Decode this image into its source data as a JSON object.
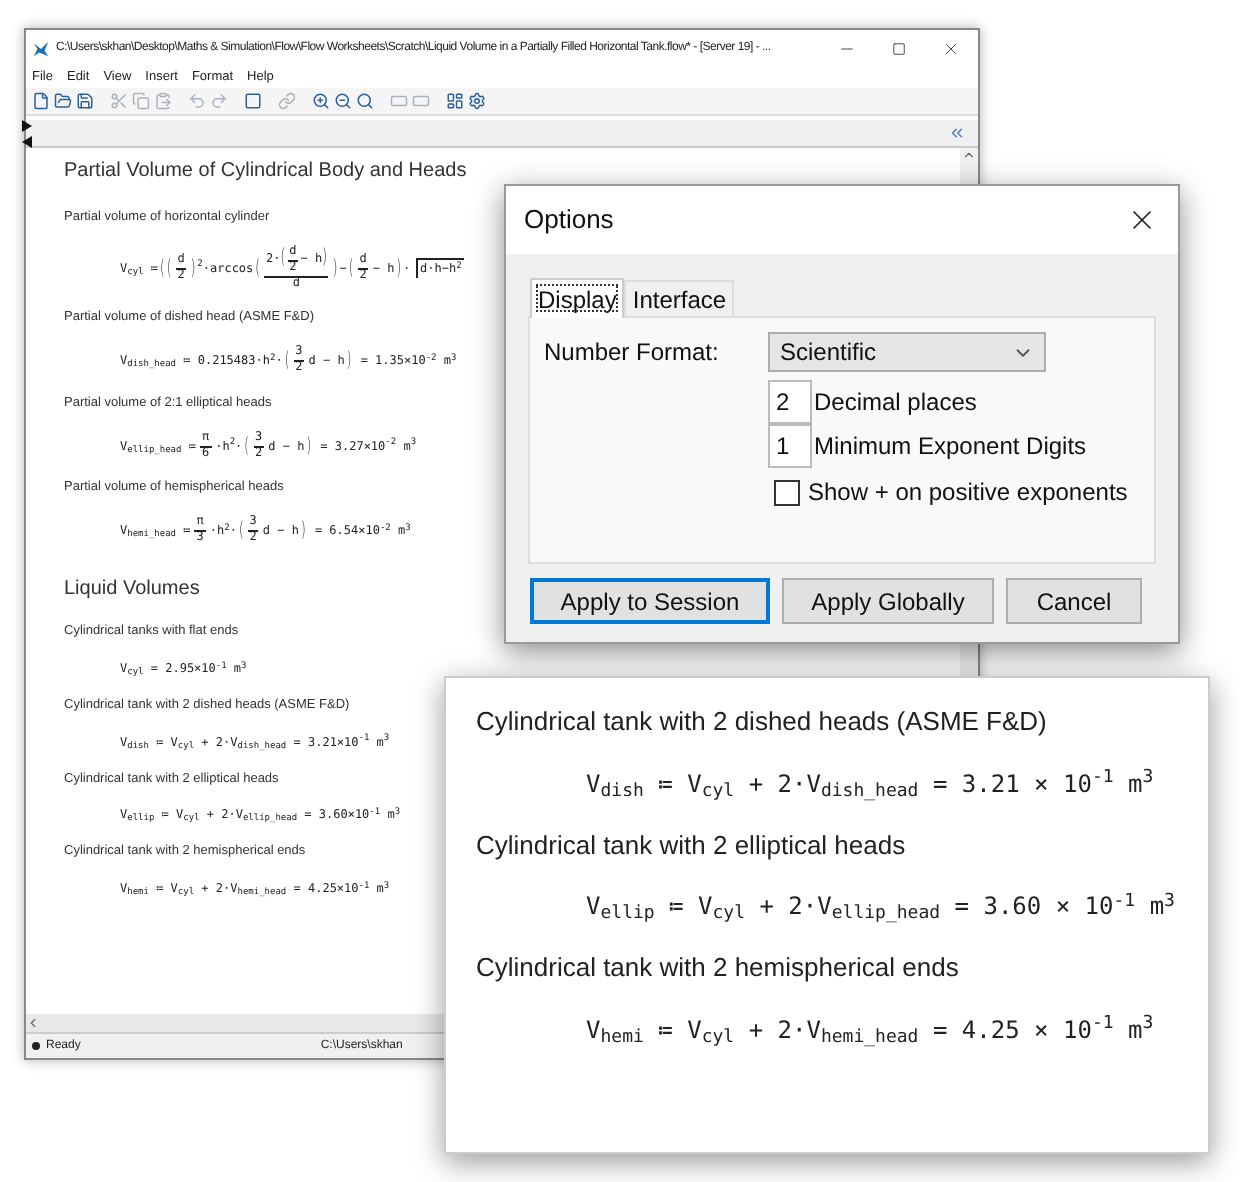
{
  "main_window": {
    "title": "C:\\Users\\skhan\\Desktop\\Maths & Simulation\\Flow\\Flow Worksheets\\Scratch\\Liquid Volume in a Partially Filled Horizontal Tank.flow* - [Server 19] - ...",
    "menu": [
      "File",
      "Edit",
      "View",
      "Insert",
      "Format",
      "Help"
    ],
    "toolbar": [
      {
        "kind": "new",
        "disabled": false
      },
      {
        "kind": "open",
        "disabled": false
      },
      {
        "kind": "save",
        "disabled": false
      },
      {
        "kind": "separator"
      },
      {
        "kind": "cut",
        "disabled": true
      },
      {
        "kind": "copy",
        "disabled": true
      },
      {
        "kind": "paste",
        "disabled": true
      },
      {
        "kind": "separator"
      },
      {
        "kind": "undo",
        "disabled": true
      },
      {
        "kind": "redo",
        "disabled": true
      },
      {
        "kind": "separator"
      },
      {
        "kind": "region",
        "disabled": false
      },
      {
        "kind": "separator"
      },
      {
        "kind": "link",
        "disabled": true
      },
      {
        "kind": "separator"
      },
      {
        "kind": "zoom_in",
        "disabled": false
      },
      {
        "kind": "zoom_out",
        "disabled": false
      },
      {
        "kind": "zoom",
        "disabled": false
      },
      {
        "kind": "separator"
      },
      {
        "kind": "area",
        "disabled": true
      },
      {
        "kind": "area",
        "disabled": true
      },
      {
        "kind": "separator"
      },
      {
        "kind": "panels",
        "disabled": false
      },
      {
        "kind": "settings",
        "disabled": false
      }
    ],
    "content": [
      {
        "kind": "heading",
        "text": "Partial Volume of Cylindrical Body and Heads"
      },
      {
        "kind": "note",
        "text": "Partial volume of horizontal cylinder"
      },
      {
        "kind": "equation",
        "parts": [
          {
            "kind": "text",
            "s": "V$_{cyl}$ ≔"
          },
          {
            "kind": "paren",
            "s": "("
          },
          {
            "kind": "paren",
            "s": "("
          },
          {
            "kind": "frac",
            "num": [
              {
                "kind": "text",
                "s": "d"
              }
            ],
            "den": [
              {
                "kind": "text",
                "s": "2"
              }
            ]
          },
          {
            "kind": "paren",
            "s": ")"
          },
          {
            "kind": "text",
            "s": "$^{2}$·arccos"
          },
          {
            "kind": "paren",
            "s": "("
          },
          {
            "kind": "frac",
            "num": [
              {
                "kind": "text",
                "s": "2·"
              },
              {
                "kind": "paren",
                "s": "("
              },
              {
                "kind": "frac",
                "num": [
                  {
                    "kind": "text",
                    "s": "d"
                  }
                ],
                "den": [
                  {
                    "kind": "text",
                    "s": "2"
                  }
                ]
              },
              {
                "kind": "text",
                "s": "− h"
              },
              {
                "kind": "paren",
                "s": ")"
              }
            ],
            "den": [
              {
                "kind": "text",
                "s": "d"
              }
            ]
          },
          {
            "kind": "paren",
            "s": ")"
          },
          {
            "kind": "text",
            "s": "−"
          },
          {
            "kind": "paren",
            "s": "("
          },
          {
            "kind": "frac",
            "num": [
              {
                "kind": "text",
                "s": "d"
              }
            ],
            "den": [
              {
                "kind": "text",
                "s": "2"
              }
            ]
          },
          {
            "kind": "text",
            "s": "− h"
          },
          {
            "kind": "paren",
            "s": ")"
          },
          {
            "kind": "text",
            "s": "·"
          },
          {
            "kind": "sqrt",
            "body": [
              {
                "kind": "text",
                "s": "d·h−h$^{2}$"
              }
            ]
          }
        ]
      },
      {
        "kind": "note",
        "text": "Partial volume of dished head (ASME F&D)"
      },
      {
        "kind": "equation",
        "parts": [
          {
            "kind": "text",
            "s": "V$_{dish_head}$ ≔ 0.215483·h$^{2}$·"
          },
          {
            "kind": "paren",
            "s": "("
          },
          {
            "kind": "frac",
            "num": [
              {
                "kind": "text",
                "s": "3"
              }
            ],
            "den": [
              {
                "kind": "text",
                "s": "2"
              }
            ]
          },
          {
            "kind": "text",
            "s": "d − h"
          },
          {
            "kind": "paren",
            "s": ")"
          },
          {
            "kind": "text",
            "s": " = 1.35×10$^{-2}$ m$^{3}$"
          }
        ]
      },
      {
        "kind": "note",
        "text": "Partial volume of 2:1 elliptical heads"
      },
      {
        "kind": "equation",
        "parts": [
          {
            "kind": "text",
            "s": "V$_{ellip_head}$ ≔"
          },
          {
            "kind": "frac",
            "num": [
              {
                "kind": "text",
                "s": "π"
              }
            ],
            "den": [
              {
                "kind": "text",
                "s": "6"
              }
            ]
          },
          {
            "kind": "text",
            "s": "·h$^{2}$·"
          },
          {
            "kind": "paren",
            "s": "("
          },
          {
            "kind": "frac",
            "num": [
              {
                "kind": "text",
                "s": "3"
              }
            ],
            "den": [
              {
                "kind": "text",
                "s": "2"
              }
            ]
          },
          {
            "kind": "text",
            "s": "d − h"
          },
          {
            "kind": "paren",
            "s": ")"
          },
          {
            "kind": "text",
            "s": " = 3.27×10$^{-2}$ m$^{3}$"
          }
        ]
      },
      {
        "kind": "note",
        "text": "Partial volume of hemispherical heads"
      },
      {
        "kind": "equation",
        "parts": [
          {
            "kind": "text",
            "s": "V$_{hemi_head}$ ≔"
          },
          {
            "kind": "frac",
            "num": [
              {
                "kind": "text",
                "s": "π"
              }
            ],
            "den": [
              {
                "kind": "text",
                "s": "3"
              }
            ]
          },
          {
            "kind": "text",
            "s": "·h$^{2}$·"
          },
          {
            "kind": "paren",
            "s": "("
          },
          {
            "kind": "frac",
            "num": [
              {
                "kind": "text",
                "s": "3"
              }
            ],
            "den": [
              {
                "kind": "text",
                "s": "2"
              }
            ]
          },
          {
            "kind": "text",
            "s": "d − h"
          },
          {
            "kind": "paren",
            "s": ")"
          },
          {
            "kind": "text",
            "s": " = 6.54×10$^{-2}$ m$^{3}$"
          }
        ]
      },
      {
        "kind": "heading",
        "text": "Liquid Volumes"
      },
      {
        "kind": "note",
        "text": "Cylindrical tanks with flat ends"
      },
      {
        "kind": "equation",
        "parts": [
          {
            "kind": "text",
            "s": "V$_{cyl}$ = 2.95×10$^{-1}$ m$^{3}$"
          }
        ]
      },
      {
        "kind": "note",
        "text": "Cylindrical tank with 2 dished heads (ASME F&D)"
      },
      {
        "kind": "equation",
        "parts": [
          {
            "kind": "text",
            "s": "V$_{dish}$ ≔ V$_{cyl}$ + 2·V$_{dish_head}$ = 3.21×10$^{-1}$ m$^{3}$"
          }
        ]
      },
      {
        "kind": "note",
        "text": "Cylindrical tank with 2 elliptical heads"
      },
      {
        "kind": "equation",
        "parts": [
          {
            "kind": "text",
            "s": "V$_{ellip}$ ≔ V$_{cyl}$ + 2·V$_{ellip_head}$ = 3.60×10$^{-1}$ m$^{3}$"
          }
        ]
      },
      {
        "kind": "note",
        "text": "Cylindrical tank with 2 hemispherical ends"
      },
      {
        "kind": "equation",
        "parts": [
          {
            "kind": "text",
            "s": "V$_{hemi}$ ≔ V$_{cyl}$ + 2·V$_{hemi_head}$ = 4.25×10$^{-1}$ m$^{3}$"
          }
        ]
      }
    ],
    "status_bar": {
      "state": "Ready",
      "path": "C:\\Users\\skhan"
    }
  },
  "options_dialog": {
    "title": "Options",
    "tabs": [
      {
        "label": "Display",
        "selected": true
      },
      {
        "label": "Interface",
        "selected": false
      }
    ],
    "number_format": {
      "label": "Number Format:",
      "value": "Scientific"
    },
    "fields": [
      {
        "value": "2",
        "label": "Decimal places"
      },
      {
        "value": "1",
        "label": "Minimum Exponent Digits"
      }
    ],
    "checkbox": {
      "label": "Show + on positive exponents",
      "checked": false
    },
    "buttons": [
      {
        "label": "Apply to Session",
        "focused": true
      },
      {
        "label": "Apply Globally",
        "focused": false
      },
      {
        "label": "Cancel",
        "focused": false
      }
    ]
  },
  "zoom_callout": {
    "content": [
      {
        "kind": "note",
        "text": "Cylindrical tank with 2 dished heads (ASME F&D)"
      },
      {
        "kind": "equation",
        "parts": [
          {
            "kind": "text",
            "s": "V$_{dish}$ ≔ V$_{cyl}$ + 2·V$_{dish_head}$ = 3.21 × 10$^{-1}$ m$^{3}$"
          }
        ]
      },
      {
        "kind": "note",
        "text": "Cylindrical tank with 2 elliptical heads"
      },
      {
        "kind": "equation",
        "parts": [
          {
            "kind": "text",
            "s": "V$_{ellip}$ ≔ V$_{cyl}$ + 2·V$_{ellip_head}$ = 3.60 × 10$^{-1}$ m$^{3}$"
          }
        ]
      },
      {
        "kind": "note",
        "text": "Cylindrical tank with 2 hemispherical ends"
      },
      {
        "kind": "equation",
        "parts": [
          {
            "kind": "text",
            "s": "V$_{hemi}$ ≔ V$_{cyl}$ + 2·V$_{hemi_head}$ = 4.25 × 10$^{-1}$ m$^{3}$"
          }
        ]
      }
    ]
  }
}
